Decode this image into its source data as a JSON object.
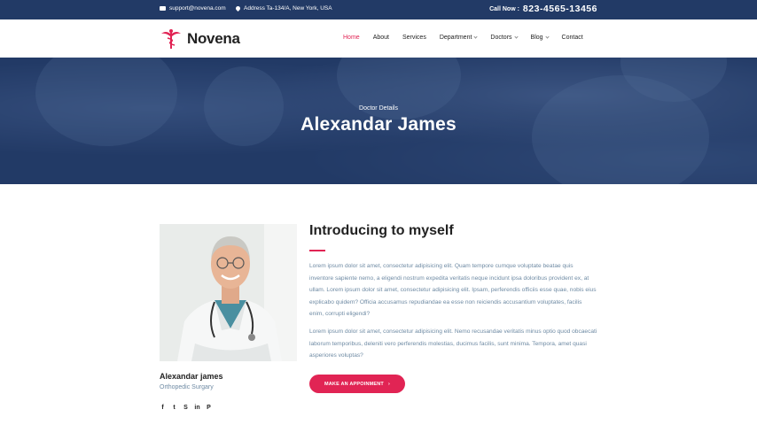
{
  "topbar": {
    "email": "support@novena.com",
    "address": "Address Ta-134/A, New York, USA",
    "call_label": "Call Now :",
    "phone": "823-4565-13456"
  },
  "brand": {
    "name": "Novena",
    "accent": "#e12454",
    "navy": "#223a66"
  },
  "nav": {
    "items": [
      {
        "label": "Home",
        "active": true,
        "dropdown": false
      },
      {
        "label": "About",
        "active": false,
        "dropdown": false
      },
      {
        "label": "Services",
        "active": false,
        "dropdown": false
      },
      {
        "label": "Department",
        "active": false,
        "dropdown": true
      },
      {
        "label": "Doctors",
        "active": false,
        "dropdown": true
      },
      {
        "label": "Blog",
        "active": false,
        "dropdown": true
      },
      {
        "label": "Contact",
        "active": false,
        "dropdown": false
      }
    ]
  },
  "hero": {
    "subtitle": "Doctor Details",
    "title": "Alexandar James"
  },
  "doctor": {
    "name": "Alexandar james",
    "role": "Orthopedic Surgary",
    "social": [
      {
        "icon": "facebook-icon",
        "glyph": "f"
      },
      {
        "icon": "twitter-icon",
        "glyph": "t"
      },
      {
        "icon": "skype-icon",
        "glyph": "S"
      },
      {
        "icon": "linkedin-icon",
        "glyph": "in"
      },
      {
        "icon": "pinterest-icon",
        "glyph": "P"
      }
    ]
  },
  "intro": {
    "heading": "Introducing to myself",
    "paragraph1": "Lorem ipsum dolor sit amet, consectetur adipisicing elit. Quam tempore cumque voluptate beatae quis inventore sapiente nemo, a eligendi nostrum expedita veritatis neque incidunt ipsa doloribus provident ex, at ullam. Lorem ipsum dolor sit amet, consectetur adipisicing elit. Ipsam, perferendis officiis esse quae, nobis eius explicabo quidem? Officia accusamus repudiandae ea esse non reiciendis accusantium voluptates, facilis enim, corrupti eligendi?",
    "paragraph2": "Lorem ipsum dolor sit amet, consectetur adipisicing elit. Nemo recusandae veritatis minus optio quod obcaecati laborum temporibus, deleniti vero perferendis molestias, ducimus facilis, sunt minima. Tempora, amet quasi asperiores voluptas?",
    "button_label": "MAKE AN APPOINMENT",
    "button_arrow": "›"
  }
}
